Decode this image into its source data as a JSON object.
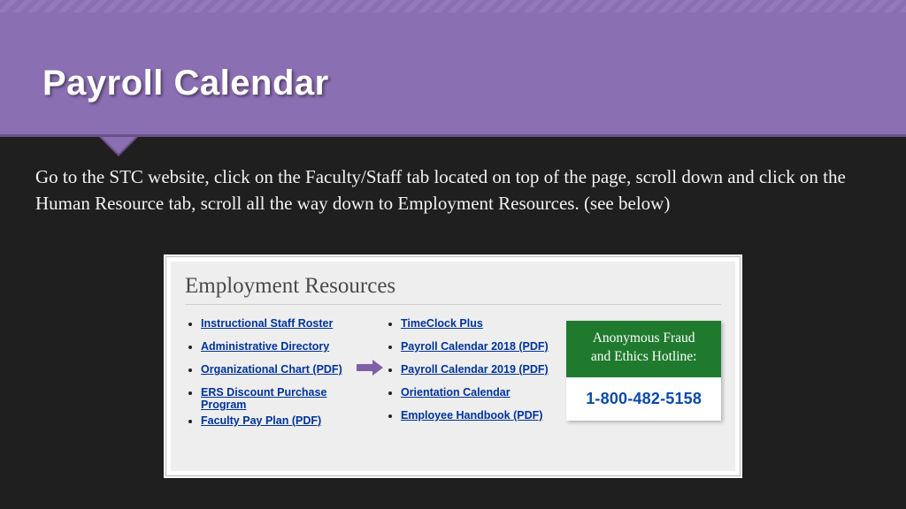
{
  "slide": {
    "title": "Payroll Calendar",
    "body": "Go to the STC website, click on the Faculty/Staff tab located on top of the page, scroll down and click on the Human Resource tab, scroll all the way down to Employment Resources. (see below)"
  },
  "panel": {
    "heading": "Employment Resources",
    "col1": [
      "Instructional Staff Roster",
      "Administrative Directory",
      "Organizational Chart (PDF)",
      "ERS Discount Purchase Program",
      "Faculty Pay Plan (PDF)"
    ],
    "col2": [
      "TimeClock Plus",
      "Payroll Calendar 2018 (PDF)",
      "Payroll Calendar 2019 (PDF)",
      "Orientation Calendar",
      "Employee Handbook (PDF)"
    ],
    "hotline": {
      "line1": "Anonymous Fraud",
      "line2": "and Ethics Hotline:",
      "phone": "1-800-482-5158"
    }
  },
  "colors": {
    "headerPurple": "#8b6fb3",
    "bgDark": "#1f1f1f",
    "linkBlue": "#003399",
    "hotlineGreen": "#1f7a2e"
  }
}
